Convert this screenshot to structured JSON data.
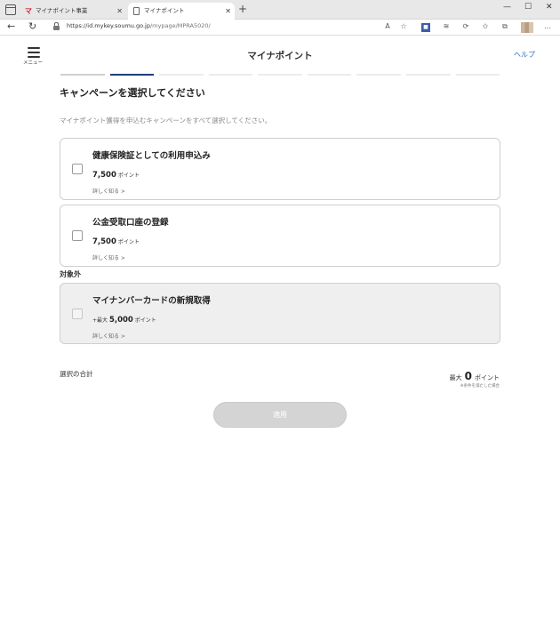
{
  "browser": {
    "tabs": [
      {
        "title": "マイナポイント事業",
        "favicon": "mynapoint-logo-icon",
        "active": false
      },
      {
        "title": "マイナポイント",
        "favicon": "page-icon",
        "active": true
      }
    ],
    "url_host": "https://id.mykey.soumu.go.jp",
    "url_path": "/mypage/MPRA5020/"
  },
  "header": {
    "menu_label": "メニュー",
    "title": "マイナポイント",
    "help": "ヘルプ"
  },
  "progress": {
    "steps_total": 9,
    "current_step": 2
  },
  "main": {
    "heading": "キャンペーンを選択してください",
    "lead": "マイナポイント獲得を申込むキャンペーンをすべて選択してください。",
    "campaigns": [
      {
        "title": "健康保険証としての利用申込み",
        "prefix": "",
        "points": "7,500",
        "unit": "ポイント",
        "more": "詳しく知る >",
        "checked": false,
        "disabled": false
      },
      {
        "title": "公金受取口座の登録",
        "prefix": "",
        "points": "7,500",
        "unit": "ポイント",
        "more": "詳しく知る >",
        "checked": false,
        "disabled": false
      }
    ],
    "excluded_label": "対象外",
    "excluded": [
      {
        "title": "マイナンバーカードの新規取得",
        "prefix": "+最大",
        "points": "5,000",
        "unit": "ポイント",
        "more": "詳しく知る >",
        "checked": false,
        "disabled": true
      }
    ],
    "total": {
      "label": "選択の合計",
      "prefix": "最大",
      "value": "0",
      "unit": "ポイント",
      "note": "※条件を満たした場合"
    },
    "apply_button": "適用"
  },
  "colors": {
    "accent": "#1f3e78",
    "link": "#2b6fc9",
    "disabled_button": "#d4d4d4"
  }
}
